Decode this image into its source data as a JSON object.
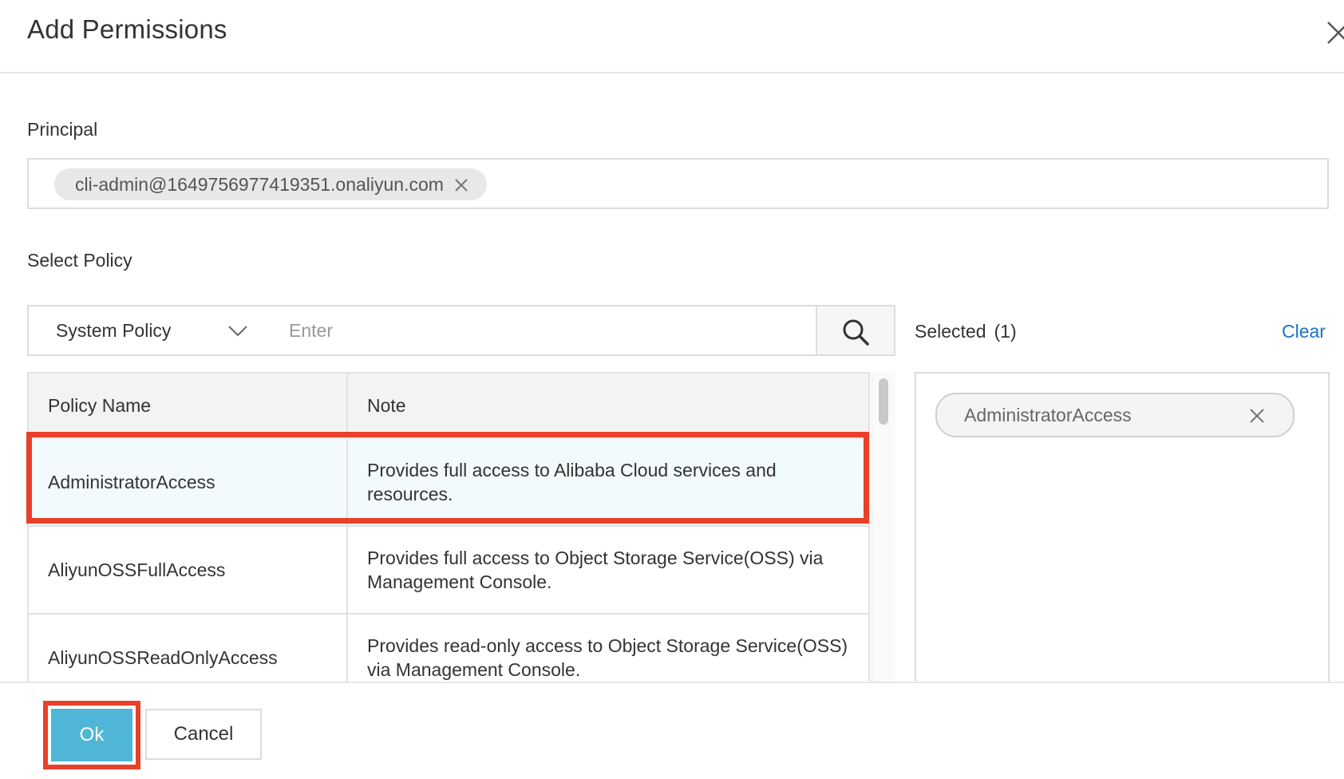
{
  "dialog": {
    "title": "Add Permissions"
  },
  "principal": {
    "label": "Principal",
    "tag": "cli-admin@1649756977419351.onaliyun.com"
  },
  "policy": {
    "label": "Select Policy",
    "type_select_value": "System Policy",
    "search_placeholder": "Enter",
    "columns": [
      "Policy Name",
      "Note"
    ],
    "rows": [
      {
        "name": "AdministratorAccess",
        "note": "Provides full access to Alibaba Cloud services and resources.",
        "selected": true
      },
      {
        "name": "AliyunOSSFullAccess",
        "note": "Provides full access to Object Storage Service(OSS) via Management Console.",
        "selected": false
      },
      {
        "name": "AliyunOSSReadOnlyAccess",
        "note": "Provides read-only access to Object Storage Service(OSS) via Management Console.",
        "selected": false
      }
    ]
  },
  "selected_panel": {
    "title": "Selected",
    "count": "(1)",
    "clear_label": "Clear",
    "items": [
      "AdministratorAccess"
    ]
  },
  "footer": {
    "ok_label": "Ok",
    "cancel_label": "Cancel"
  },
  "colors": {
    "primary_button": "#4fb6d8",
    "highlight_outline": "#e8402a",
    "link": "#1a72c4",
    "selected_row_bg": "#f2fafc"
  },
  "icons": {
    "close": "close-icon",
    "tag_remove": "close-icon",
    "dropdown": "chevron-down-icon",
    "search": "search-icon"
  }
}
